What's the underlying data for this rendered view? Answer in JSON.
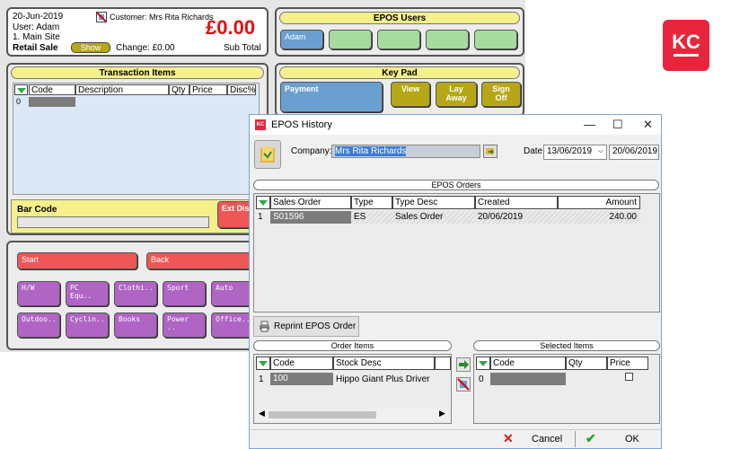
{
  "pos": {
    "date": "20-Jun-2019",
    "user": "User: Adam",
    "site": "1. Main Site",
    "mode": "Retail Sale",
    "show_label": "Show",
    "customer": "Customer: Mrs Rita Richards",
    "total": "£0.00",
    "change": "Change: £0.00",
    "subtotal": "Sub Total",
    "epos_users_title": "EPOS Users",
    "user_button": "Adam",
    "transaction_title": "Transaction Items",
    "trans_cols": [
      "Code",
      "Description",
      "Qty",
      "Price",
      "Disc%"
    ],
    "trans_row_num": "0",
    "barcode_label": "Bar Code",
    "ext_disc": "Ext Disc",
    "start_label": "Start",
    "back_label": "Back",
    "categories_row1": [
      "H/W",
      "PC Equ..",
      "Clothi..",
      "Sport",
      "Auto"
    ],
    "categories_row2": [
      "Outdoo..",
      "Cyclin..",
      "Books",
      "Power ..",
      "Office.."
    ],
    "keypad_title": "Key Pad",
    "payment": "Payment",
    "view": "View",
    "layaway": "Lay Away",
    "signoff": "Sign Off"
  },
  "dialog": {
    "title": "EPOS History",
    "icon_text": "KC",
    "company_label": "Company:",
    "company_value": "Mrs Rita Richards",
    "date_label": "Date:",
    "date_from": "13/06/2019",
    "date_to": "20/06/2019",
    "orders_title": "EPOS Orders",
    "orders_cols": [
      "Sales Order",
      "Type",
      "Type Desc",
      "Created",
      "Amount"
    ],
    "orders_rows": [
      {
        "num": "1",
        "order": "S01596",
        "type": "ES",
        "desc": "Sales Order",
        "created": "20/06/2019",
        "amount": "240.00"
      }
    ],
    "reprint_label": "Reprint EPOS Order",
    "order_items_title": "Order Items",
    "order_items_cols": [
      "Code",
      "Stock Desc"
    ],
    "order_items_rows": [
      {
        "num": "1",
        "code": "100",
        "desc": "Hippo Giant Plus Driver"
      }
    ],
    "selected_items_title": "Selected Items",
    "selected_cols": [
      "Code",
      "Qty",
      "Price"
    ],
    "selected_row_num": "0",
    "cancel_label": "Cancel",
    "ok_label": "OK"
  },
  "logo": {
    "text": "KC",
    "color": "#e8253c"
  },
  "colors": {
    "green_button": "#a7dba0",
    "blue_button": "#6a9fcf",
    "olive_button": "#b5a718",
    "red_button": "#ef5656",
    "purple_button": "#b064c4",
    "yellow_header": "#f5f08c"
  }
}
